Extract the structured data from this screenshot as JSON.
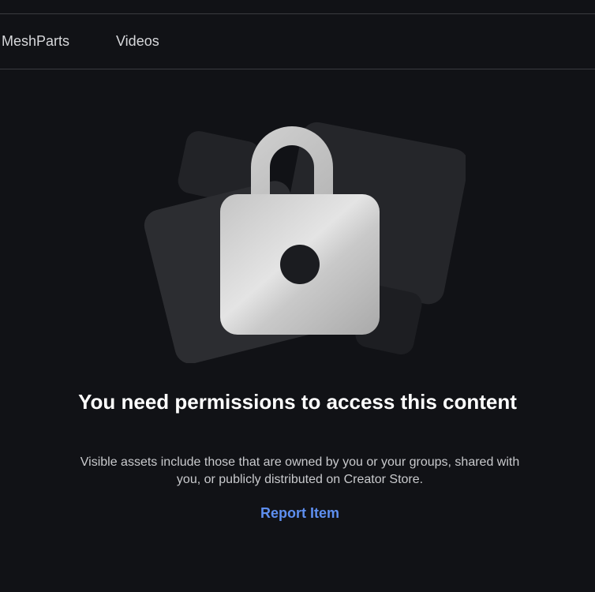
{
  "tabs": [
    {
      "label": "MeshParts"
    },
    {
      "label": "Videos"
    }
  ],
  "empty_state": {
    "icon": "lock-icon",
    "title": "You need permissions to access this content",
    "description": "Visible assets include those that are owned by you or your groups, shared with you, or publicly distributed on Creator Store.",
    "link_label": "Report Item"
  },
  "colors": {
    "background": "#111216",
    "link": "#5e8ff0",
    "lock": "#d6d6d6"
  }
}
